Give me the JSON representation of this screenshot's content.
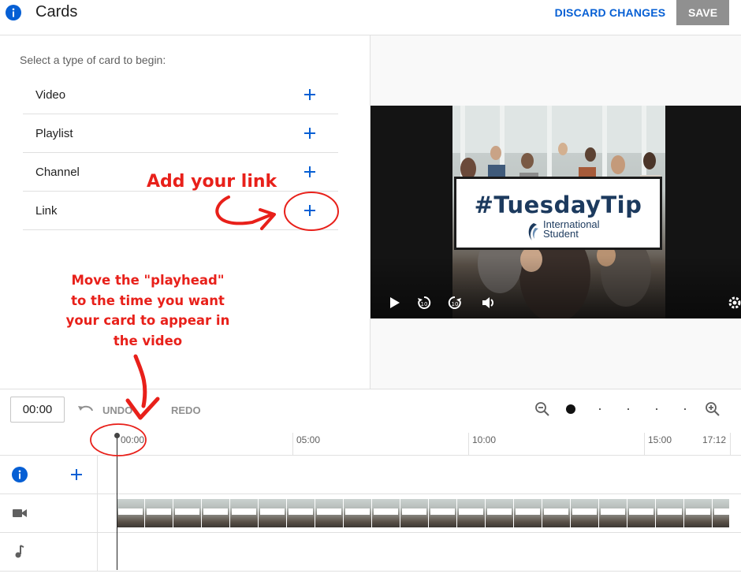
{
  "header": {
    "title": "Cards",
    "discard_label": "DISCARD CHANGES",
    "save_label": "SAVE"
  },
  "left_panel": {
    "prompt": "Select a type of card to begin:",
    "card_types": [
      {
        "label": "Video"
      },
      {
        "label": "Playlist"
      },
      {
        "label": "Channel"
      },
      {
        "label": "Link"
      }
    ]
  },
  "preview": {
    "overlay_title": "#TuesdayTip",
    "brand_line1": "International",
    "brand_line2": "Student"
  },
  "toolbar": {
    "current_time": "00:00",
    "undo_label": "UNDO",
    "redo_label": "REDO"
  },
  "timeline": {
    "ticks": [
      "00:00",
      "05:00",
      "10:00",
      "15:00",
      "17:12"
    ],
    "playhead_time": "00:00"
  },
  "annotations": {
    "add_link": "Add your link",
    "playhead_note": [
      "Move the \"playhead\"",
      "to the time you want",
      "your card to appear in",
      "the video"
    ]
  },
  "colors": {
    "accent_blue": "#065fd4",
    "annotation_red": "#e8201a",
    "save_bg": "#909090"
  },
  "icons": {
    "header": "info-icon",
    "card_add": "plus-icon",
    "tracks": [
      "info-icon",
      "video-camera-icon",
      "music-note-icon"
    ],
    "player": [
      "play-icon",
      "rewind-10-icon",
      "forward-10-icon",
      "volume-icon",
      "settings-icon"
    ]
  }
}
